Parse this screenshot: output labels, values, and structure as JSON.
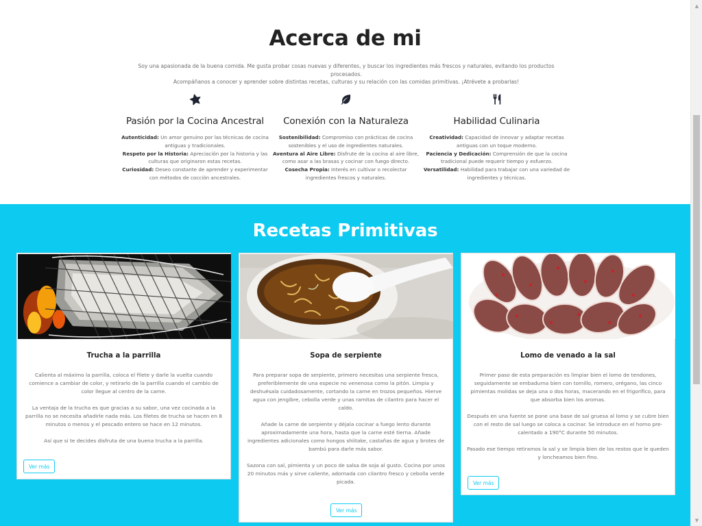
{
  "about": {
    "title": "Acerca de mi",
    "intro_line1": "Soy una apasionada de la buena comida. Me gusta probar cosas nuevas y diferentes, y buscar los ingredientes más frescos y naturales, evitando los productos procesados.",
    "intro_line2": "Acompáñanos a conocer y aprender sobre distintas recetas, culturas y su relación con las comidas primitivas. ¡Atrévete a probarlas!",
    "features": [
      {
        "icon": "star-icon",
        "title": "Pasión por la Cocina Ancestral",
        "items": [
          {
            "label": "Autenticidad:",
            "text": "Un amor genuino por las técnicas de cocina antiguas y tradicionales."
          },
          {
            "label": "Respeto por la Historia:",
            "text": "Apreciación por la historia y las culturas que originaron estas recetas."
          },
          {
            "label": "Curiosidad:",
            "text": "Deseo constante de aprender y experimentar con métodos de cocción ancestrales."
          }
        ]
      },
      {
        "icon": "leaf-icon",
        "title": "Conexión con la Naturaleza",
        "items": [
          {
            "label": "Sostenibilidad:",
            "text": "Compromiso con prácticas de cocina sostenibles y el uso de ingredientes naturales."
          },
          {
            "label": "Aventura al Aire Libre:",
            "text": "Disfrute de la cocina al aire libre, como asar a las brasas y cocinar con fuego directo."
          },
          {
            "label": "Cosecha Propia:",
            "text": "Interés en cultivar o recolectar ingredientes frescos y naturales."
          }
        ]
      },
      {
        "icon": "utensils-icon",
        "title": "Habilidad Culinaria",
        "items": [
          {
            "label": "Creatividad:",
            "text": "Capacidad de innovar y adaptar recetas antiguas con un toque moderno."
          },
          {
            "label": "Paciencia y Dedicación:",
            "text": "Comprensión de que la cocina tradicional puede requerir tiempo y esfuerzo."
          },
          {
            "label": "Versatilidad:",
            "text": "Habilidad para trabajar con una variedad de ingredientes y técnicas."
          }
        ]
      }
    ]
  },
  "recipes": {
    "title": "Recetas Primitivas",
    "button_label": "Ver más",
    "cards": [
      {
        "title": "Trucha a la parrilla",
        "paragraphs": [
          "Calienta al máximo la parrilla, coloca el filete y darle la vuelta cuando comience a cambiar de color, y retirarlo de la parrilla cuando el cambio de color llegue al centro de la carne.",
          "La ventaja de la trucha es que gracias a su sabor, una vez cocinada a la parrilla no se necesita añadirle nada más. Los filetes de trucha se hacen en 8 minutos o menos y el pescado entero se hace en 12 minutos.",
          "Así que si te decides disfruta de una buena trucha a la parrilla."
        ]
      },
      {
        "title": "Sopa de serpiente",
        "paragraphs": [
          "Para preparar sopa de serpiente, primero necesitas una serpiente fresca, preferiblemente de una especie no venenosa como la pitón. Limpia y deshuésala cuidadosamente, cortando la carne en trozos pequeños. Hierve agua con jengibre, cebolla verde y unas ramitas de cilantro para hacer el caldo.",
          "Añade la carne de serpiente y déjala cocinar a fuego lento durante aproximadamente una hora, hasta que la carne esté tierna. Añade ingredientes adicionales como hongos shiitake, castañas de agua y brotes de bambú para darle más sabor.",
          "Sazona con sal, pimienta y un poco de salsa de soja al gusto. Cocina por unos 20 minutos más y sirve caliente, adornada con cilantro fresco y cebolla verde picada."
        ]
      },
      {
        "title": "Lomo de venado a la sal",
        "paragraphs": [
          "Primer paso de esta preparación es limpiar bien el lomo de tendones, seguidamente se embadurna bien con tomillo, romero, orégano, las cinco pimientas molidas se deja una o dos horas, macerando en el frigorífico, para que absorba bien los aromas.",
          "Después en una fuente se pone una base de sal gruesa al lomo y se cubre bien con el resto de sal luego se coloca a cocinar. Se introduce en el horno pre-calentado a 190°C durante 50 minutos.",
          "Pasado ese tiempo retiramos la sal y se limpia bien de los restos que le queden y loncheamos bien fino."
        ]
      }
    ]
  },
  "colors": {
    "accent": "#0dcaf0",
    "heading": "#222222"
  }
}
